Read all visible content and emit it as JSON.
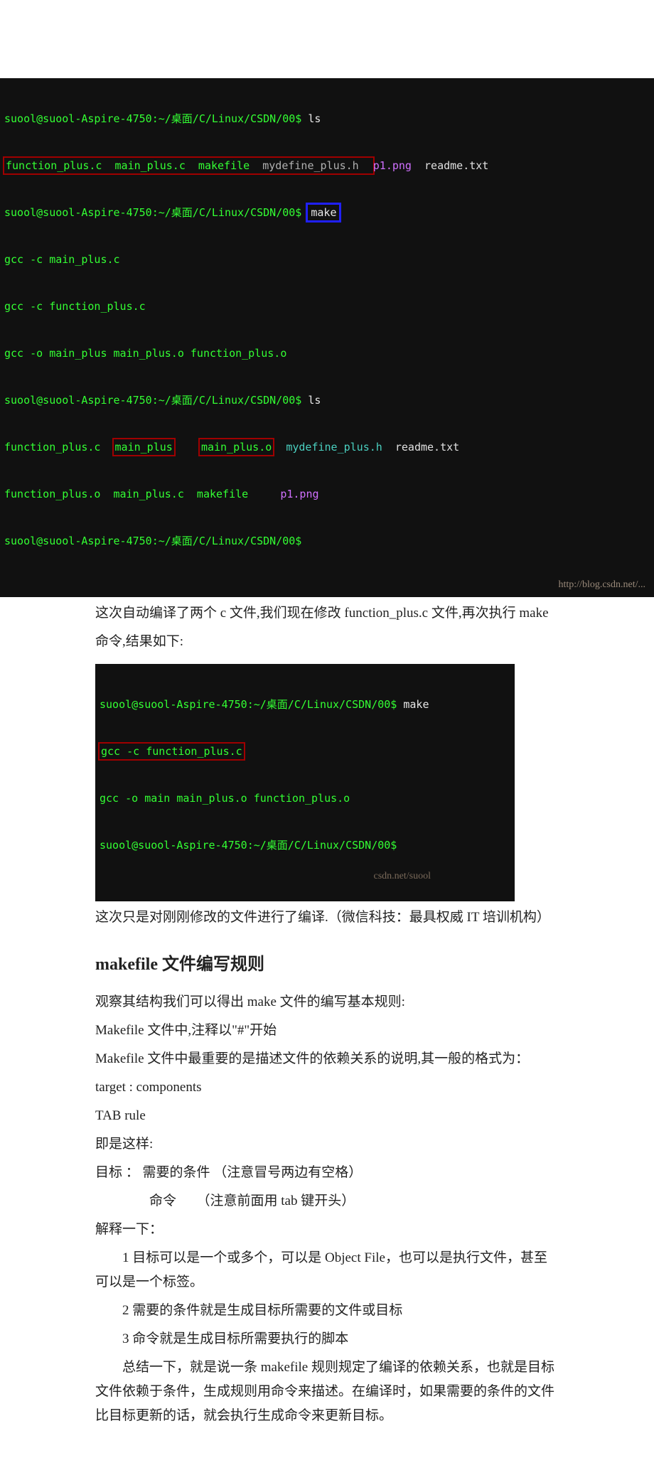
{
  "term1": {
    "l1_prompt": "suool@suool-Aspire-4750:~/桌面/C/Linux/CSDN/00$ ",
    "l1_cmd": "ls",
    "l2_a": "function_plus.c  main_plus.c  makefile  ",
    "l2_b": "mydefine_plus.h  ",
    "l2_c": "p1.png  ",
    "l2_d": "readme.txt",
    "l3_prompt": "suool@suool-Aspire-4750:~/桌面/C/Linux/CSDN/00$ ",
    "l3_cmd": "make",
    "l4": "gcc -c main_plus.c",
    "l5": "gcc -c function_plus.c",
    "l6": "gcc -o main_plus main_plus.o function_plus.o",
    "l7_prompt": "suool@suool-Aspire-4750:~/桌面/C/Linux/CSDN/00$ ",
    "l7_cmd": "ls",
    "l8_a": "function_plus.c  ",
    "l8_b": "main_plus",
    "l8_c": "    ",
    "l8_d": "main_plus.o",
    "l8_e": "  ",
    "l8_f": "mydefine_plus.h  ",
    "l8_g": "readme.txt",
    "l9_a": "function_plus.o  main_plus.c  makefile     ",
    "l9_b": "p1.png",
    "l10_prompt": "suool@suool-Aspire-4750:~/桌面/C/Linux/CSDN/00$ ",
    "watermark": "http://blog.csdn.net/..."
  },
  "p1": "这次自动编译了两个 c 文件,我们现在修改 function_plus.c 文件,再次执行 make",
  "p2": "命令,结果如下:",
  "term2": {
    "l1_prompt": "suool@suool-Aspire-4750:~/桌面/C/Linux/CSDN/00$ ",
    "l1_cmd": "make",
    "l2": "gcc -c function_plus.c",
    "l3": "gcc -o main main_plus.o function_plus.o",
    "l4_prompt": "suool@suool-Aspire-4750:~/桌面/C/Linux/CSDN/00$ ",
    "watermark": "csdn.net/suool"
  },
  "p3": "这次只是对刚刚修改的文件进行了编译.（微信科技：最具权威 IT 培训机构）",
  "h2": "makefile 文件编写规则",
  "p4": "观察其结构我们可以得出 make 文件的编写基本规则:",
  "p5": "Makefile 文件中,注释以\"#\"开始",
  "p6": "Makefile 文件中最重要的是描述文件的依赖关系的说明,其一般的格式为：",
  "p7": "target : components",
  "p8": "TAB rule",
  "p9": "即是这样:",
  "p10": "目标 ：  需要的条件  （注意冒号两边有空格）",
  "p11": "　　　　命令　　（注意前面用 tab 键开头）",
  "p12": "解释一下：",
  "p13": "1  目标可以是一个或多个，可以是 Object File，也可以是执行文件，甚至可以是一个标签。",
  "p14": "2  需要的条件就是生成目标所需要的文件或目标",
  "p15": "3  命令就是生成目标所需要执行的脚本",
  "p16": "总结一下，就是说一条 makefile 规则规定了编译的依赖关系，也就是目标文件依赖于条件，生成规则用命令来描述。在编译时，如果需要的条件的文件比目标更新的话，就会执行生成命令来更新目标。"
}
